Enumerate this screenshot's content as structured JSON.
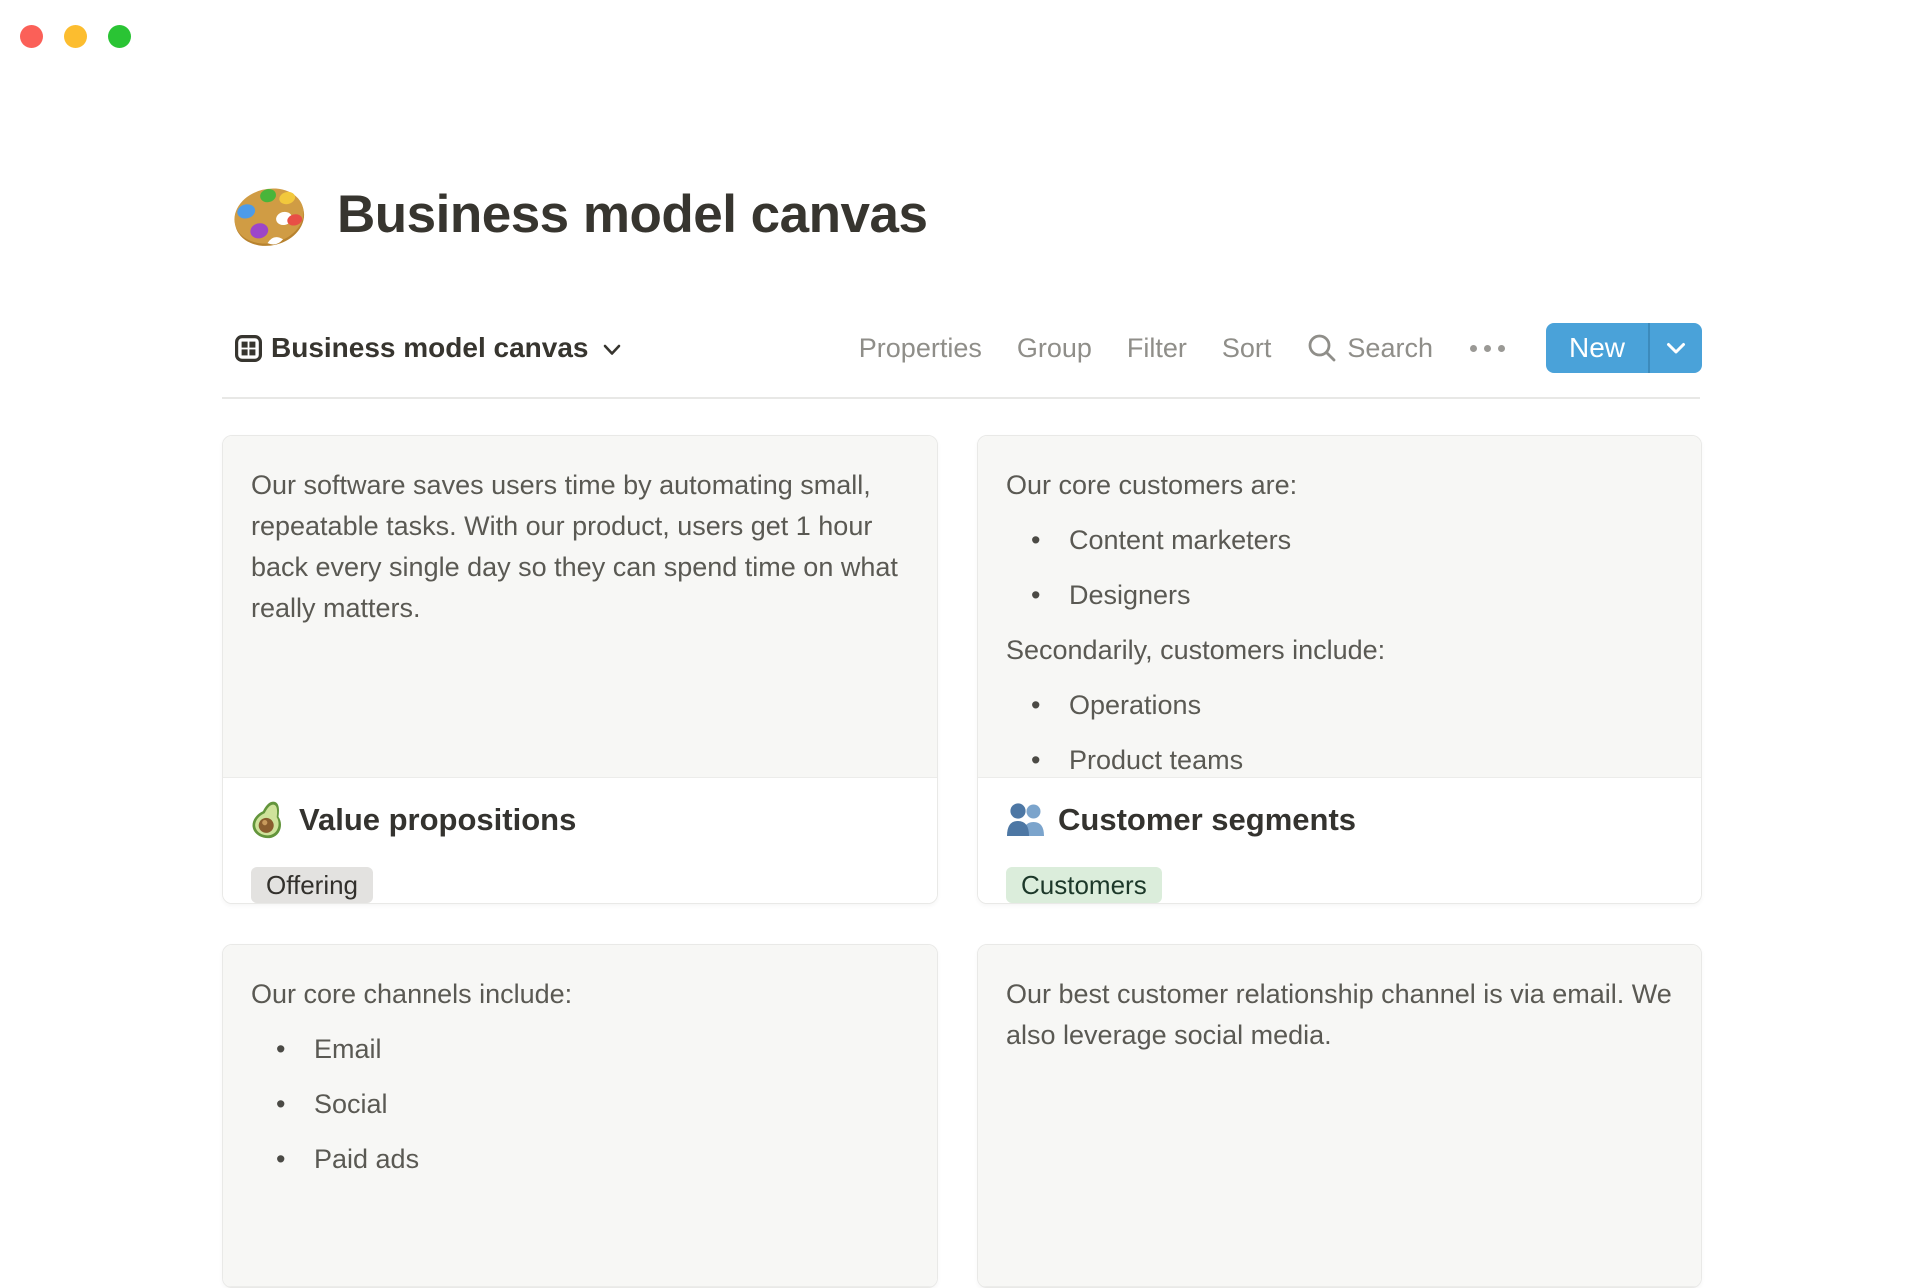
{
  "window": {
    "traffic_lights": [
      {
        "name": "close-button",
        "color": "#fb6058"
      },
      {
        "name": "minimize-button",
        "color": "#fcbd2f"
      },
      {
        "name": "zoom-button",
        "color": "#2ac434"
      }
    ]
  },
  "page": {
    "icon": "palette-emoji",
    "title": "Business model canvas"
  },
  "view_bar": {
    "view": {
      "icon": "gallery-view-icon",
      "label": "Business model canvas",
      "chevron": "chevron-down-icon"
    },
    "toolbar": {
      "items": [
        {
          "label": "Properties"
        },
        {
          "label": "Group"
        },
        {
          "label": "Filter"
        },
        {
          "label": "Sort"
        }
      ],
      "search": {
        "icon": "search-icon",
        "label": "Search"
      },
      "more": {
        "icon": "ellipsis-icon"
      },
      "new_button": {
        "label": "New",
        "color": "#4aa2d9",
        "chevron": "chevron-down-icon"
      }
    }
  },
  "gallery": {
    "cards": [
      {
        "preview": [
          {
            "type": "p",
            "text": "Our software saves users time by automating small, repeatable tasks. With our product, users get 1 hour back every single day so they can spend time on what really matters."
          }
        ],
        "footer": {
          "icon": "avocado-emoji-icon",
          "title": "Value propositions",
          "tag": {
            "label": "Offering",
            "bg": "#e3e2e0",
            "color": "#32302c"
          }
        }
      },
      {
        "preview": [
          {
            "type": "p",
            "text": "Our core customers are:"
          },
          {
            "type": "li",
            "text": "Content marketers"
          },
          {
            "type": "li",
            "text": "Designers"
          },
          {
            "type": "p",
            "text": "Secondarily, customers include:"
          },
          {
            "type": "li",
            "text": "Operations"
          },
          {
            "type": "li",
            "text": "Product teams"
          }
        ],
        "footer": {
          "icon": "busts-in-silhouette-emoji-icon",
          "title": "Customer segments",
          "tag": {
            "label": "Customers",
            "bg": "#dbeddb",
            "color": "#1c3829"
          }
        }
      },
      {
        "preview": [
          {
            "type": "p",
            "text": "Our core channels include:"
          },
          {
            "type": "li",
            "text": "Email"
          },
          {
            "type": "li",
            "text": "Social"
          },
          {
            "type": "li",
            "text": "Paid ads"
          }
        ]
      },
      {
        "preview": [
          {
            "type": "p",
            "text": "Our best customer relationship channel is via email. We also leverage social media."
          }
        ]
      }
    ]
  }
}
